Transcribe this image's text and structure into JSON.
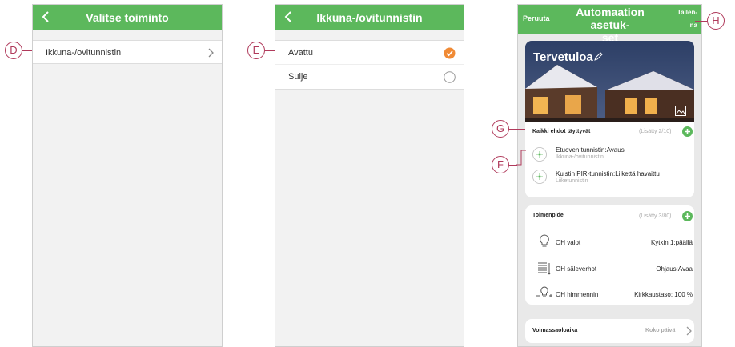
{
  "screen1": {
    "title": "Valitse toiminto",
    "item_label": "Ikkuna-/ovitunnistin",
    "callout": "D"
  },
  "screen2": {
    "title": "Ikkuna-/ovitunnistin",
    "callout": "E",
    "options": [
      {
        "label": "Avattu",
        "selected": true
      },
      {
        "label": "Sulje",
        "selected": false
      }
    ]
  },
  "screen3": {
    "cancel": "Peruuta",
    "title": "Automaation asetuk-set",
    "title_line1": "Automaation asetuk-",
    "title_line2": "set",
    "save_line1": "Tallen-",
    "save_line2": "na",
    "callout_save": "H",
    "image_title": "Tervetuloa",
    "conditions": {
      "header": "Kaikki ehdot täyttyvät",
      "count": "(Lisätty 2/10)",
      "callout": "G",
      "callout_items": "F",
      "items": [
        {
          "title": "Etuoven tunnistin:Avaus",
          "subtitle": "Ikkuna-/ovitunnistin"
        },
        {
          "title": "Kuistin PIR-tunnistin:Liikettä havaittu",
          "subtitle": "Liiketunnistin"
        }
      ]
    },
    "actions": {
      "header": "Toimenpide",
      "count": "(Lisätty 3/80)",
      "items": [
        {
          "name": "OH valot",
          "value": "Kytkin 1:päällä",
          "icon": "bulb-icon"
        },
        {
          "name": "OH säleverhot",
          "value": "Ohjaus:Avaa",
          "icon": "blinds-icon"
        },
        {
          "name": "OH himmennin",
          "value": "Kirkkaustaso: 100 %",
          "icon": "dimmer-icon"
        }
      ]
    },
    "validity": {
      "label": "Voimassaoloaika",
      "value": "Koko päivä"
    }
  },
  "colors": {
    "green": "#5cb85c",
    "callout": "#b03a5b",
    "check": "#f08a35"
  }
}
